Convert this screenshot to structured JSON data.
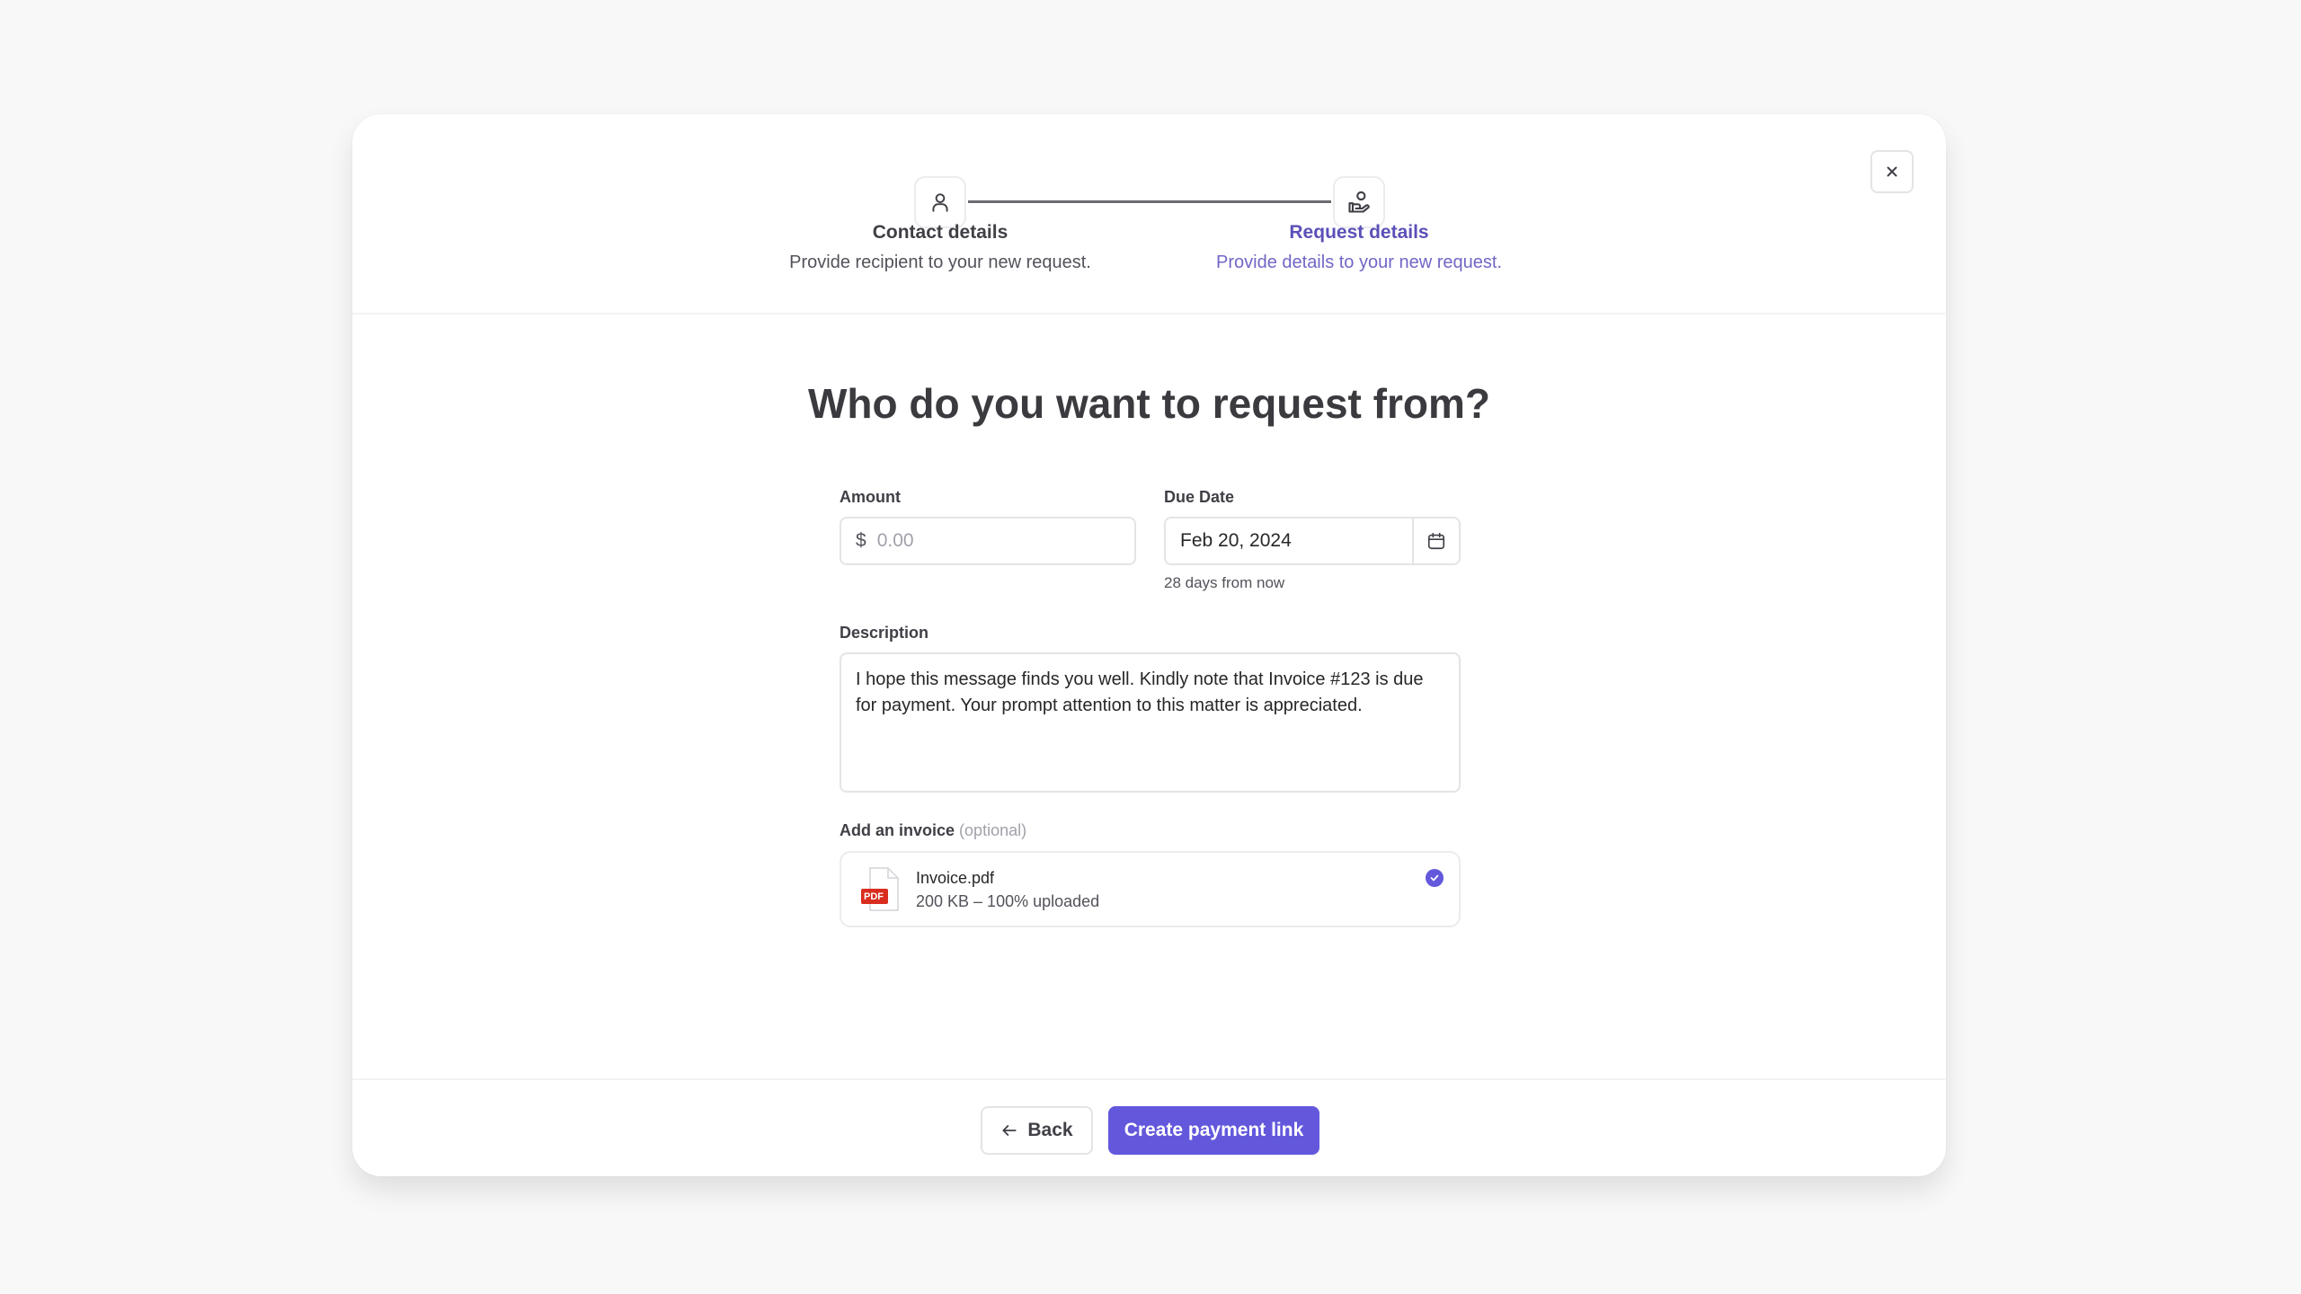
{
  "stepper": {
    "steps": [
      {
        "title": "Contact details",
        "subtitle": "Provide recipient to your new request.",
        "icon": "user-icon",
        "state": "completed"
      },
      {
        "title": "Request details",
        "subtitle": "Provide details to your new request.",
        "icon": "hand-coin-icon",
        "state": "active"
      }
    ]
  },
  "heading": "Who do you want to request from?",
  "form": {
    "amount": {
      "label": "Amount",
      "currency": "$",
      "placeholder": "0.00",
      "value": ""
    },
    "due_date": {
      "label": "Due Date",
      "value": "Feb 20, 2024",
      "hint": "28 days from now"
    },
    "description": {
      "label": "Description",
      "value": "I hope this message finds you well. Kindly note that Invoice #123 is due for payment. Your prompt attention to this matter is appreciated."
    },
    "invoice": {
      "label": "Add an invoice",
      "optional": "(optional)",
      "file_name": "Invoice.pdf",
      "file_type": "PDF",
      "file_meta": "200 KB – 100% uploaded",
      "progress_percent": 100
    }
  },
  "footer": {
    "back_label": "Back",
    "submit_label": "Create payment link"
  },
  "colors": {
    "accent": "#6358dc",
    "pdf": "#d92d20"
  }
}
